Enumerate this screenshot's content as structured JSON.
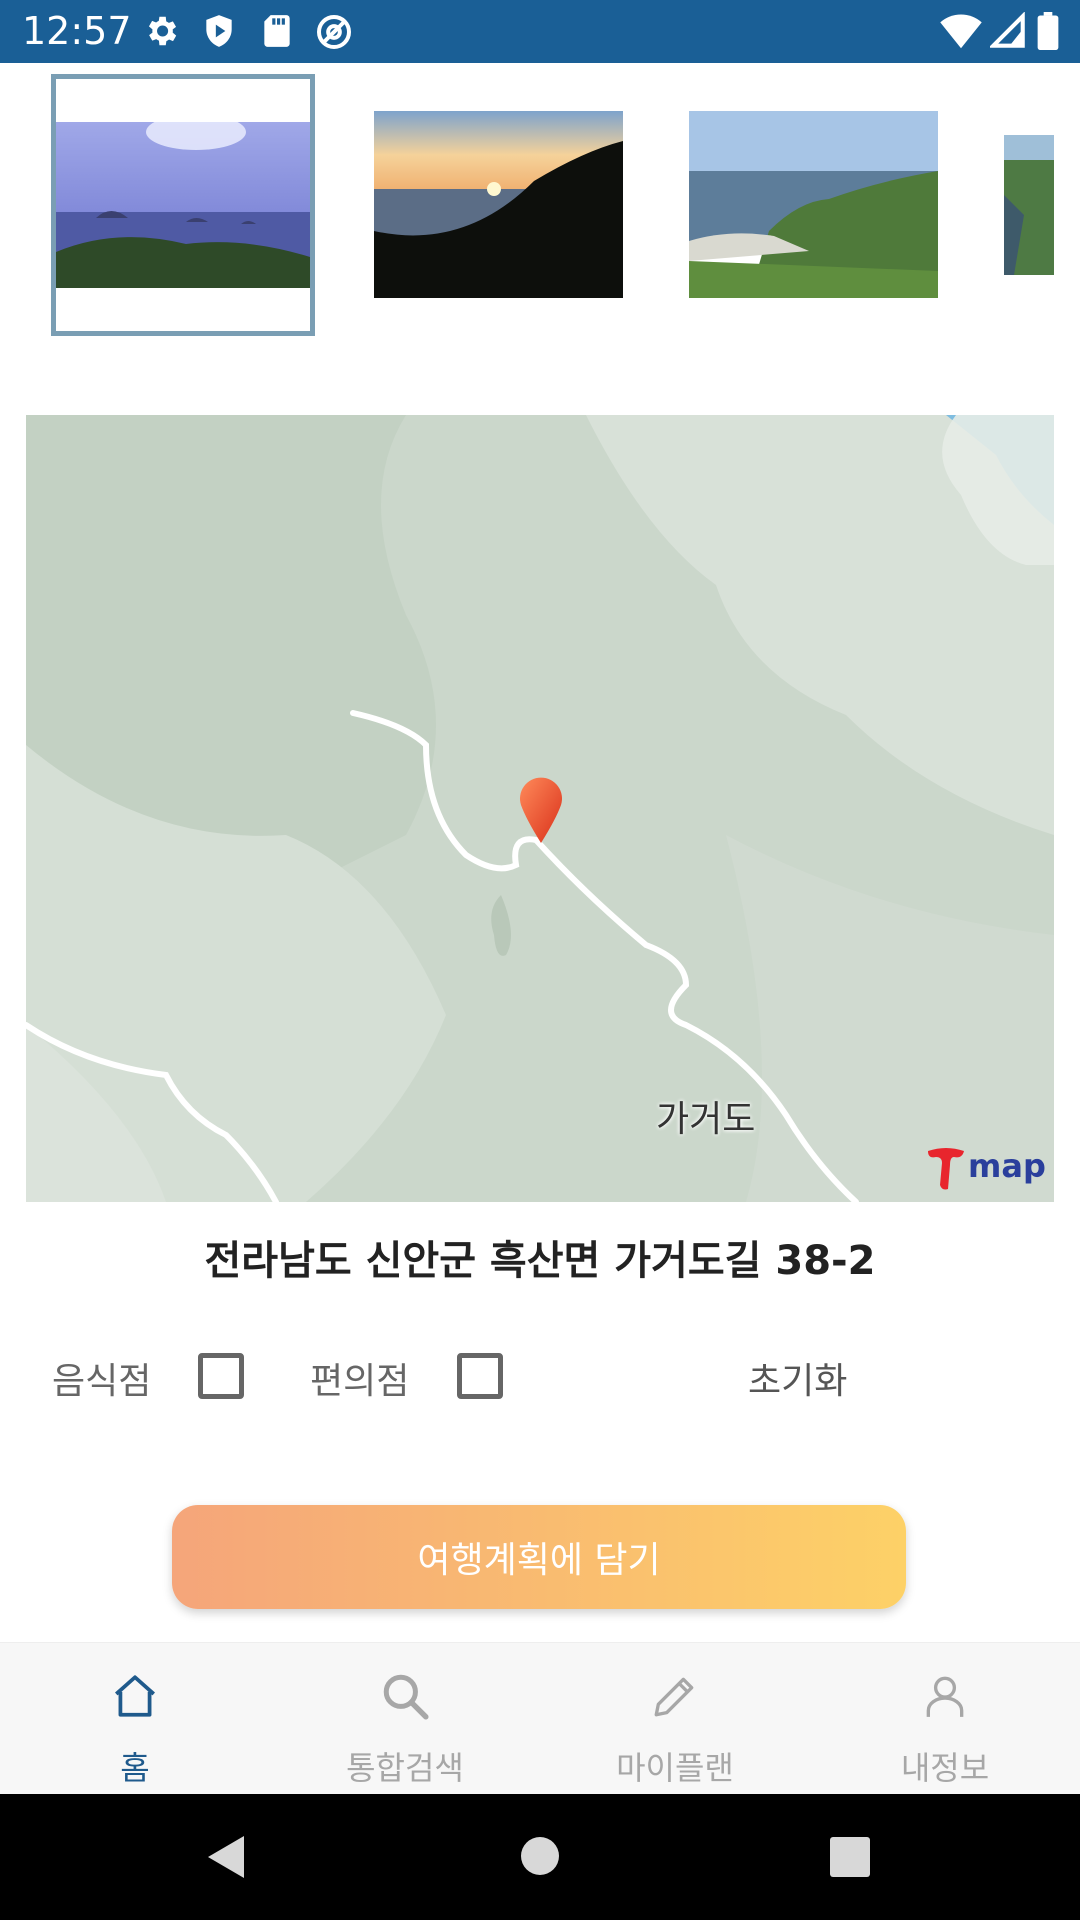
{
  "status_bar": {
    "time": "12:57",
    "left_icons": [
      "settings-icon",
      "shield-icon",
      "sd-card-icon",
      "at-sign-icon"
    ],
    "right_icons": [
      "wifi-icon",
      "signal-icon",
      "battery-icon"
    ]
  },
  "thumbnails": [
    {
      "name": "islands-blue-sky",
      "selected": true
    },
    {
      "name": "sunset-sea",
      "selected": false
    },
    {
      "name": "harbor-coast",
      "selected": false
    },
    {
      "name": "cliff-partial",
      "selected": false
    }
  ],
  "map": {
    "place_label": "가거도",
    "provider_logo": "map",
    "marker_icon": "map-pin-icon"
  },
  "address": "전라남도 신안군 흑산면 가거도길 38-2",
  "filters": {
    "restaurant_label": "음식점",
    "restaurant_checked": false,
    "convenience_label": "편의점",
    "convenience_checked": false,
    "reset_label": "초기화"
  },
  "cta": {
    "label": "여행계획에 담기"
  },
  "bottom_nav": {
    "active": "home",
    "items": [
      {
        "label": "홈",
        "icon": "home-icon"
      },
      {
        "label": "통합검색",
        "icon": "search-icon"
      },
      {
        "label": "마이플랜",
        "icon": "pencil-icon"
      },
      {
        "label": "내정보",
        "icon": "person-icon"
      }
    ]
  },
  "colors": {
    "status_bar": "#1a5f96",
    "nav_active": "#1f5a8c",
    "nav_inactive": "#a7a7a7",
    "cta_start": "#f5a57a",
    "cta_end": "#fdd167"
  }
}
